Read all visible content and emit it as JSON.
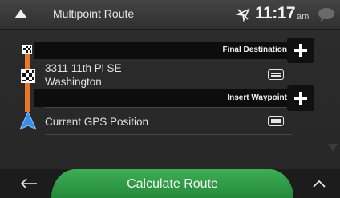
{
  "header": {
    "title": "Multipoint Route",
    "time": "11:17",
    "ampm": "am"
  },
  "route": {
    "final_destination_label": "Final Destination",
    "insert_waypoint_label": "Insert Waypoint",
    "destination": {
      "line1": "3311 11th Pl SE",
      "line2": "Washington"
    },
    "start": {
      "label": "Current GPS Position"
    }
  },
  "footer": {
    "calculate_label": "Calculate Route"
  },
  "colors": {
    "route_line": "#e8772a",
    "calculate_button": "#2f9c47",
    "position_arrow": "#3a8ee6"
  },
  "icons": [
    "menu-icon",
    "gps-off-icon",
    "message-icon",
    "checkered-flag-icon",
    "plus-icon",
    "details-icon",
    "position-arrow-icon",
    "back-arrow-icon",
    "chevron-up-icon"
  ]
}
